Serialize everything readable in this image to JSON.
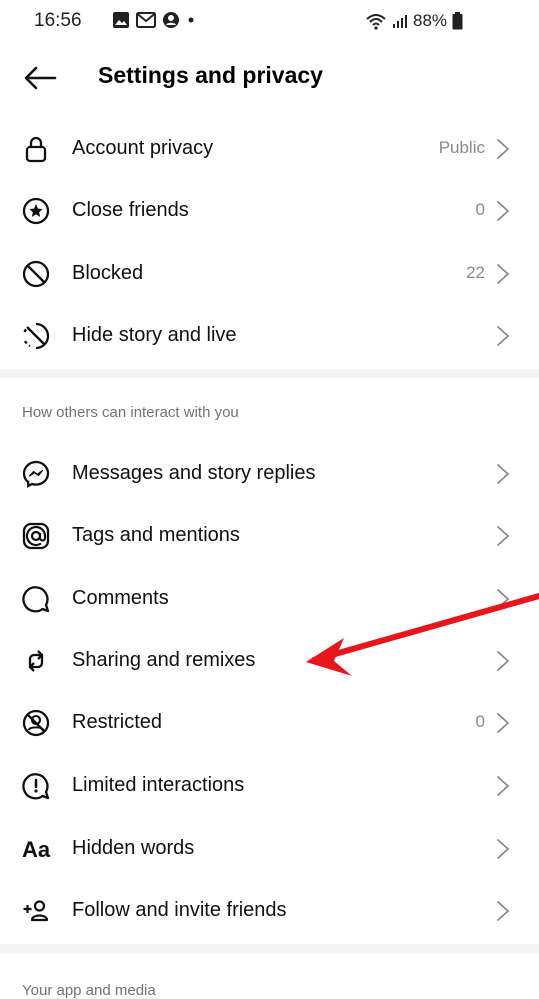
{
  "status": {
    "time": "16:56",
    "battery": "88%"
  },
  "header": {
    "title": "Settings and privacy"
  },
  "rows_top": [
    {
      "label": "Account privacy",
      "value": "Public",
      "icon": "lock-icon"
    },
    {
      "label": "Close friends",
      "value": "0",
      "icon": "star-circle-icon"
    },
    {
      "label": "Blocked",
      "value": "22",
      "icon": "blocked-icon"
    },
    {
      "label": "Hide story and live",
      "value": "",
      "icon": "hide-story-icon"
    }
  ],
  "section_interact": {
    "title": "How others can interact with you"
  },
  "rows_interact": [
    {
      "label": "Messages and story replies",
      "value": "",
      "icon": "messenger-icon"
    },
    {
      "label": "Tags and mentions",
      "value": "",
      "icon": "at-sign-icon"
    },
    {
      "label": "Comments",
      "value": "",
      "icon": "comment-icon"
    },
    {
      "label": "Sharing and remixes",
      "value": "",
      "icon": "remix-icon"
    },
    {
      "label": "Restricted",
      "value": "0",
      "icon": "restricted-icon"
    },
    {
      "label": "Limited interactions",
      "value": "",
      "icon": "limited-interactions-icon"
    },
    {
      "label": "Hidden words",
      "value": "",
      "icon": "hidden-words-icon",
      "glyph": "Aa"
    },
    {
      "label": "Follow and invite friends",
      "value": "",
      "icon": "add-person-icon"
    }
  ],
  "section_app_media": {
    "title": "Your app and media"
  },
  "annotation": {
    "color": "#e8161b"
  }
}
